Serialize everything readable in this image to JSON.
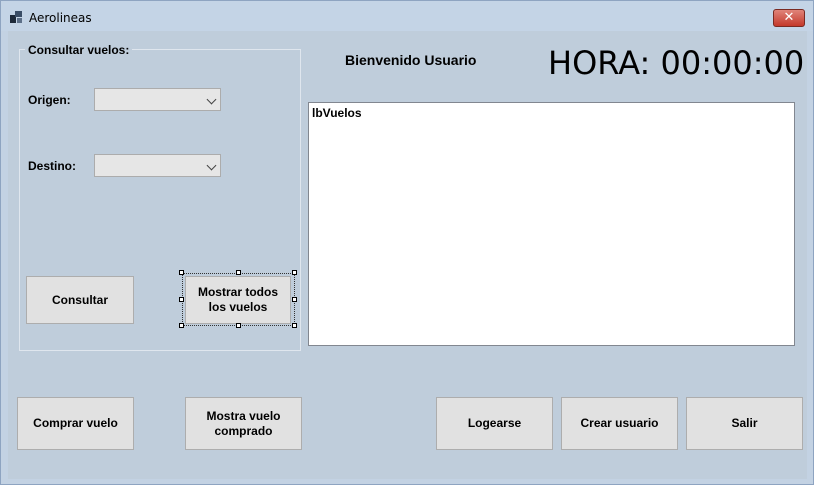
{
  "window": {
    "title": "Aerolineas",
    "close_label": "✕"
  },
  "group": {
    "title": "Consultar vuelos:"
  },
  "form": {
    "origen_label": "Origen:",
    "destino_label": "Destino:",
    "origen_value": "",
    "destino_value": ""
  },
  "buttons": {
    "consultar": "Consultar",
    "mostrar_todos": "Mostrar todos los vuelos",
    "comprar": "Comprar vuelo",
    "mostrar_comprado": "Mostra vuelo comprado",
    "logearse": "Logearse",
    "crear_usuario": "Crear usuario",
    "salir": "Salir"
  },
  "header": {
    "welcome": "Bienvenido Usuario",
    "clock": "HORA: 00:00:00"
  },
  "list": {
    "items": [
      "lbVuelos"
    ]
  }
}
